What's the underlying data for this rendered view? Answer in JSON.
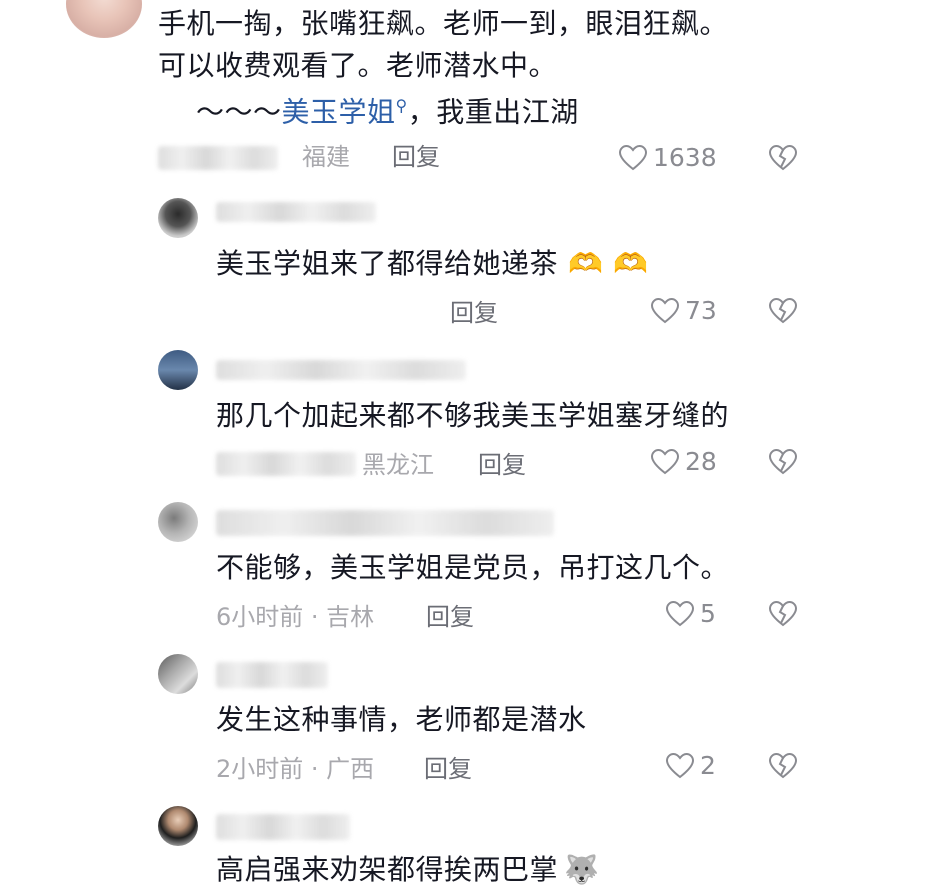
{
  "comments": [
    {
      "text_lines": [
        "手机一掏，张嘴狂飙。老师一到，眼泪狂飙。",
        "可以收费观看了。老师潜水中。"
      ],
      "line3_prefix": "～～～",
      "line3_link": "美玉学姐",
      "line3_suffix": "，我重出江湖",
      "location": "福建",
      "reply": "回复",
      "likes": "1638"
    },
    {
      "text": "美玉学姐来了都得给她递茶",
      "reply": "回复",
      "likes": "73"
    },
    {
      "text": "那几个加起来都不够我美玉学姐塞牙缝的",
      "location": "黑龙江",
      "reply": "回复",
      "likes": "28"
    },
    {
      "text": "不能够，美玉学姐是党员，吊打这几个。",
      "meta": "6小时前 · 吉林",
      "reply": "回复",
      "likes": "5"
    },
    {
      "text": "发生这种事情，老师都是潜水",
      "meta": "2小时前 · 广西",
      "reply": "回复",
      "likes": "2"
    },
    {
      "text": "高启强来劝架都得挨两巴掌"
    }
  ]
}
